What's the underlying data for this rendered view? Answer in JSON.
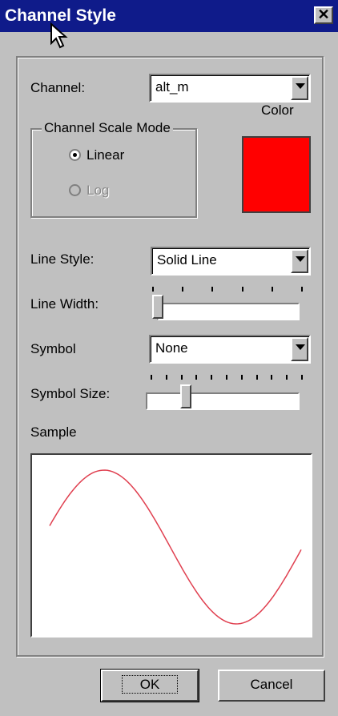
{
  "window": {
    "title": "Channel Style",
    "close_label": "✕"
  },
  "channel": {
    "label": "Channel:",
    "value": "alt_m",
    "color_label": "Color"
  },
  "scale_mode": {
    "title": "Channel Scale Mode",
    "options": [
      {
        "label": "Linear",
        "checked": true,
        "enabled": true
      },
      {
        "label": "Log",
        "checked": false,
        "enabled": false
      }
    ]
  },
  "color_swatch": {
    "color": "#ff0000"
  },
  "line_style": {
    "label": "Line Style:",
    "value": "Solid Line"
  },
  "line_width": {
    "label": "Line Width:",
    "level": 0.0
  },
  "symbol": {
    "label": "Symbol",
    "value": "None"
  },
  "symbol_size": {
    "label": "Symbol Size:",
    "level": 0.22
  },
  "sample": {
    "label": "Sample",
    "line_color": "#e04050"
  },
  "buttons": {
    "ok": "OK",
    "cancel": "Cancel"
  }
}
